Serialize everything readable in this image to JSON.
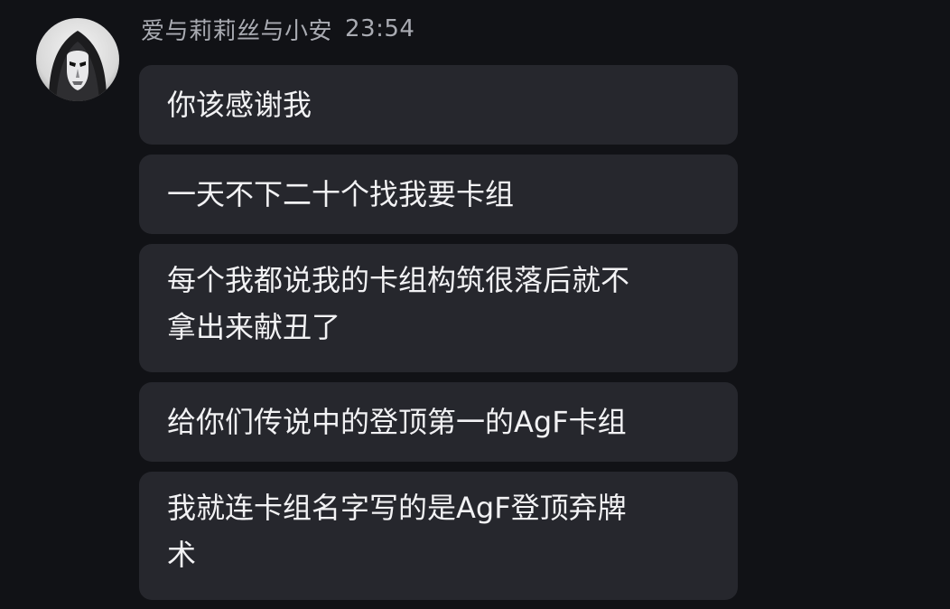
{
  "sender": {
    "name": "爱与莉莉丝与小安",
    "time": "23:54"
  },
  "messages": [
    {
      "lines": [
        "你该感谢我"
      ]
    },
    {
      "lines": [
        "一天不下二十个找我要卡组"
      ]
    },
    {
      "lines": [
        "每个我都说我的卡组构筑很落后就不",
        "拿出来献丑了"
      ]
    },
    {
      "lines": [
        "给你们传说中的登顶第一的AgF卡组"
      ]
    },
    {
      "lines": [
        "我就连卡组名字写的是AgF登顶弃牌",
        "术"
      ]
    }
  ],
  "colors": {
    "background": "#111216",
    "bubble": "#26272d",
    "text": "#f2f2f4",
    "meta_text": "#a9abb2"
  }
}
